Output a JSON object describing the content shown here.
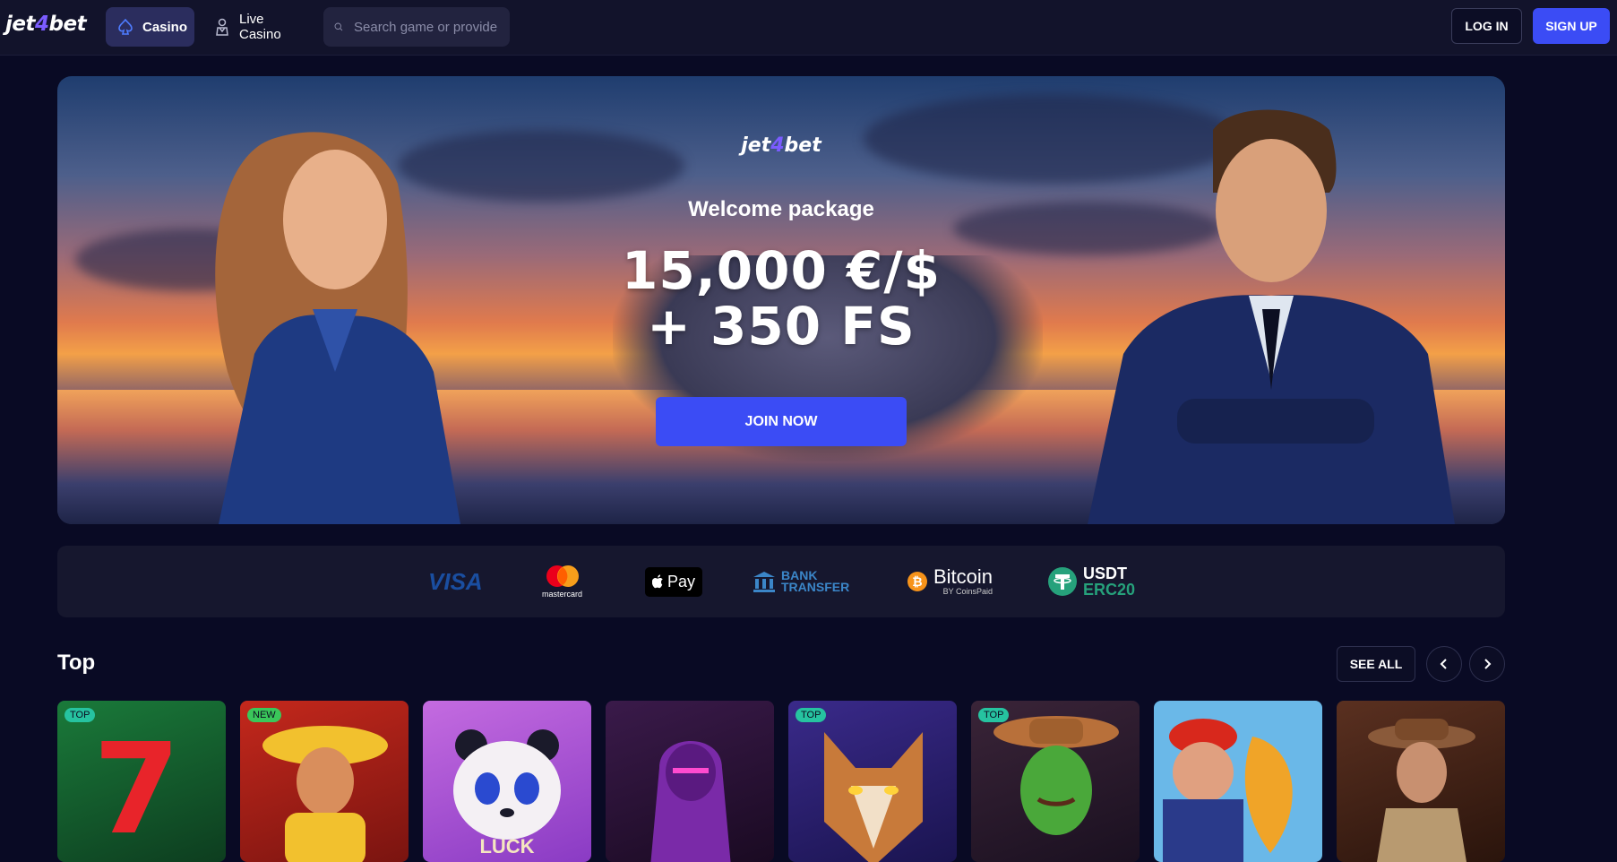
{
  "header": {
    "logo_prefix": "jet",
    "logo_four": "4",
    "logo_suffix": "bet",
    "nav": [
      {
        "label": "Casino",
        "icon": "spade-icon",
        "active": true
      },
      {
        "label": "Live Casino",
        "icon": "dealer-icon",
        "active": false
      }
    ],
    "search_placeholder": "Search game or provider",
    "login_label": "LOG IN",
    "signup_label": "SIGN UP"
  },
  "hero": {
    "logo_prefix": "jet",
    "logo_four": "4",
    "logo_suffix": "bet",
    "subtitle": "Welcome package",
    "title_line1": "15,000 €/$",
    "title_line2": "+ 350 FS",
    "cta_label": "JOIN NOW"
  },
  "payments": {
    "visa": "VISA",
    "mastercard": "mastercard",
    "apple_pay": "Pay",
    "bank_line1": "BANK",
    "bank_line2": "TRANSFER",
    "bitcoin": "Bitcoin",
    "bitcoin_by": "BY CoinsPaid",
    "usdt_line1": "USDT",
    "usdt_line2": "ERC20"
  },
  "section": {
    "title": "Top",
    "see_all_label": "SEE ALL"
  },
  "games": [
    {
      "badge": "TOP",
      "theme": "lucky-seven",
      "colors": [
        "#1a7a3a",
        "#0d3d1f"
      ]
    },
    {
      "badge": "NEW",
      "theme": "mariachi",
      "colors": [
        "#c4281c",
        "#7a1410"
      ]
    },
    {
      "badge": "",
      "theme": "panda",
      "colors": [
        "#c46be0",
        "#8a3bc4"
      ],
      "caption": "LUCK"
    },
    {
      "badge": "",
      "theme": "mummy",
      "colors": [
        "#3a1a4a",
        "#1a0a22"
      ]
    },
    {
      "badge": "TOP",
      "theme": "wolf",
      "colors": [
        "#3a2a8a",
        "#1a1450"
      ]
    },
    {
      "badge": "TOP",
      "theme": "cactus-cowboy",
      "colors": [
        "#3a2438",
        "#1a1020"
      ]
    },
    {
      "badge": "",
      "theme": "fisherman",
      "colors": [
        "#2a8ad0",
        "#e0a030"
      ]
    },
    {
      "badge": "",
      "theme": "explorer",
      "colors": [
        "#5a3020",
        "#2a140c"
      ]
    }
  ],
  "colors": {
    "accent": "#3b4cf5",
    "background": "#090a24",
    "header_bg": "#12132b",
    "badge_top": "#26c3a0",
    "badge_new": "#3ac75a"
  }
}
